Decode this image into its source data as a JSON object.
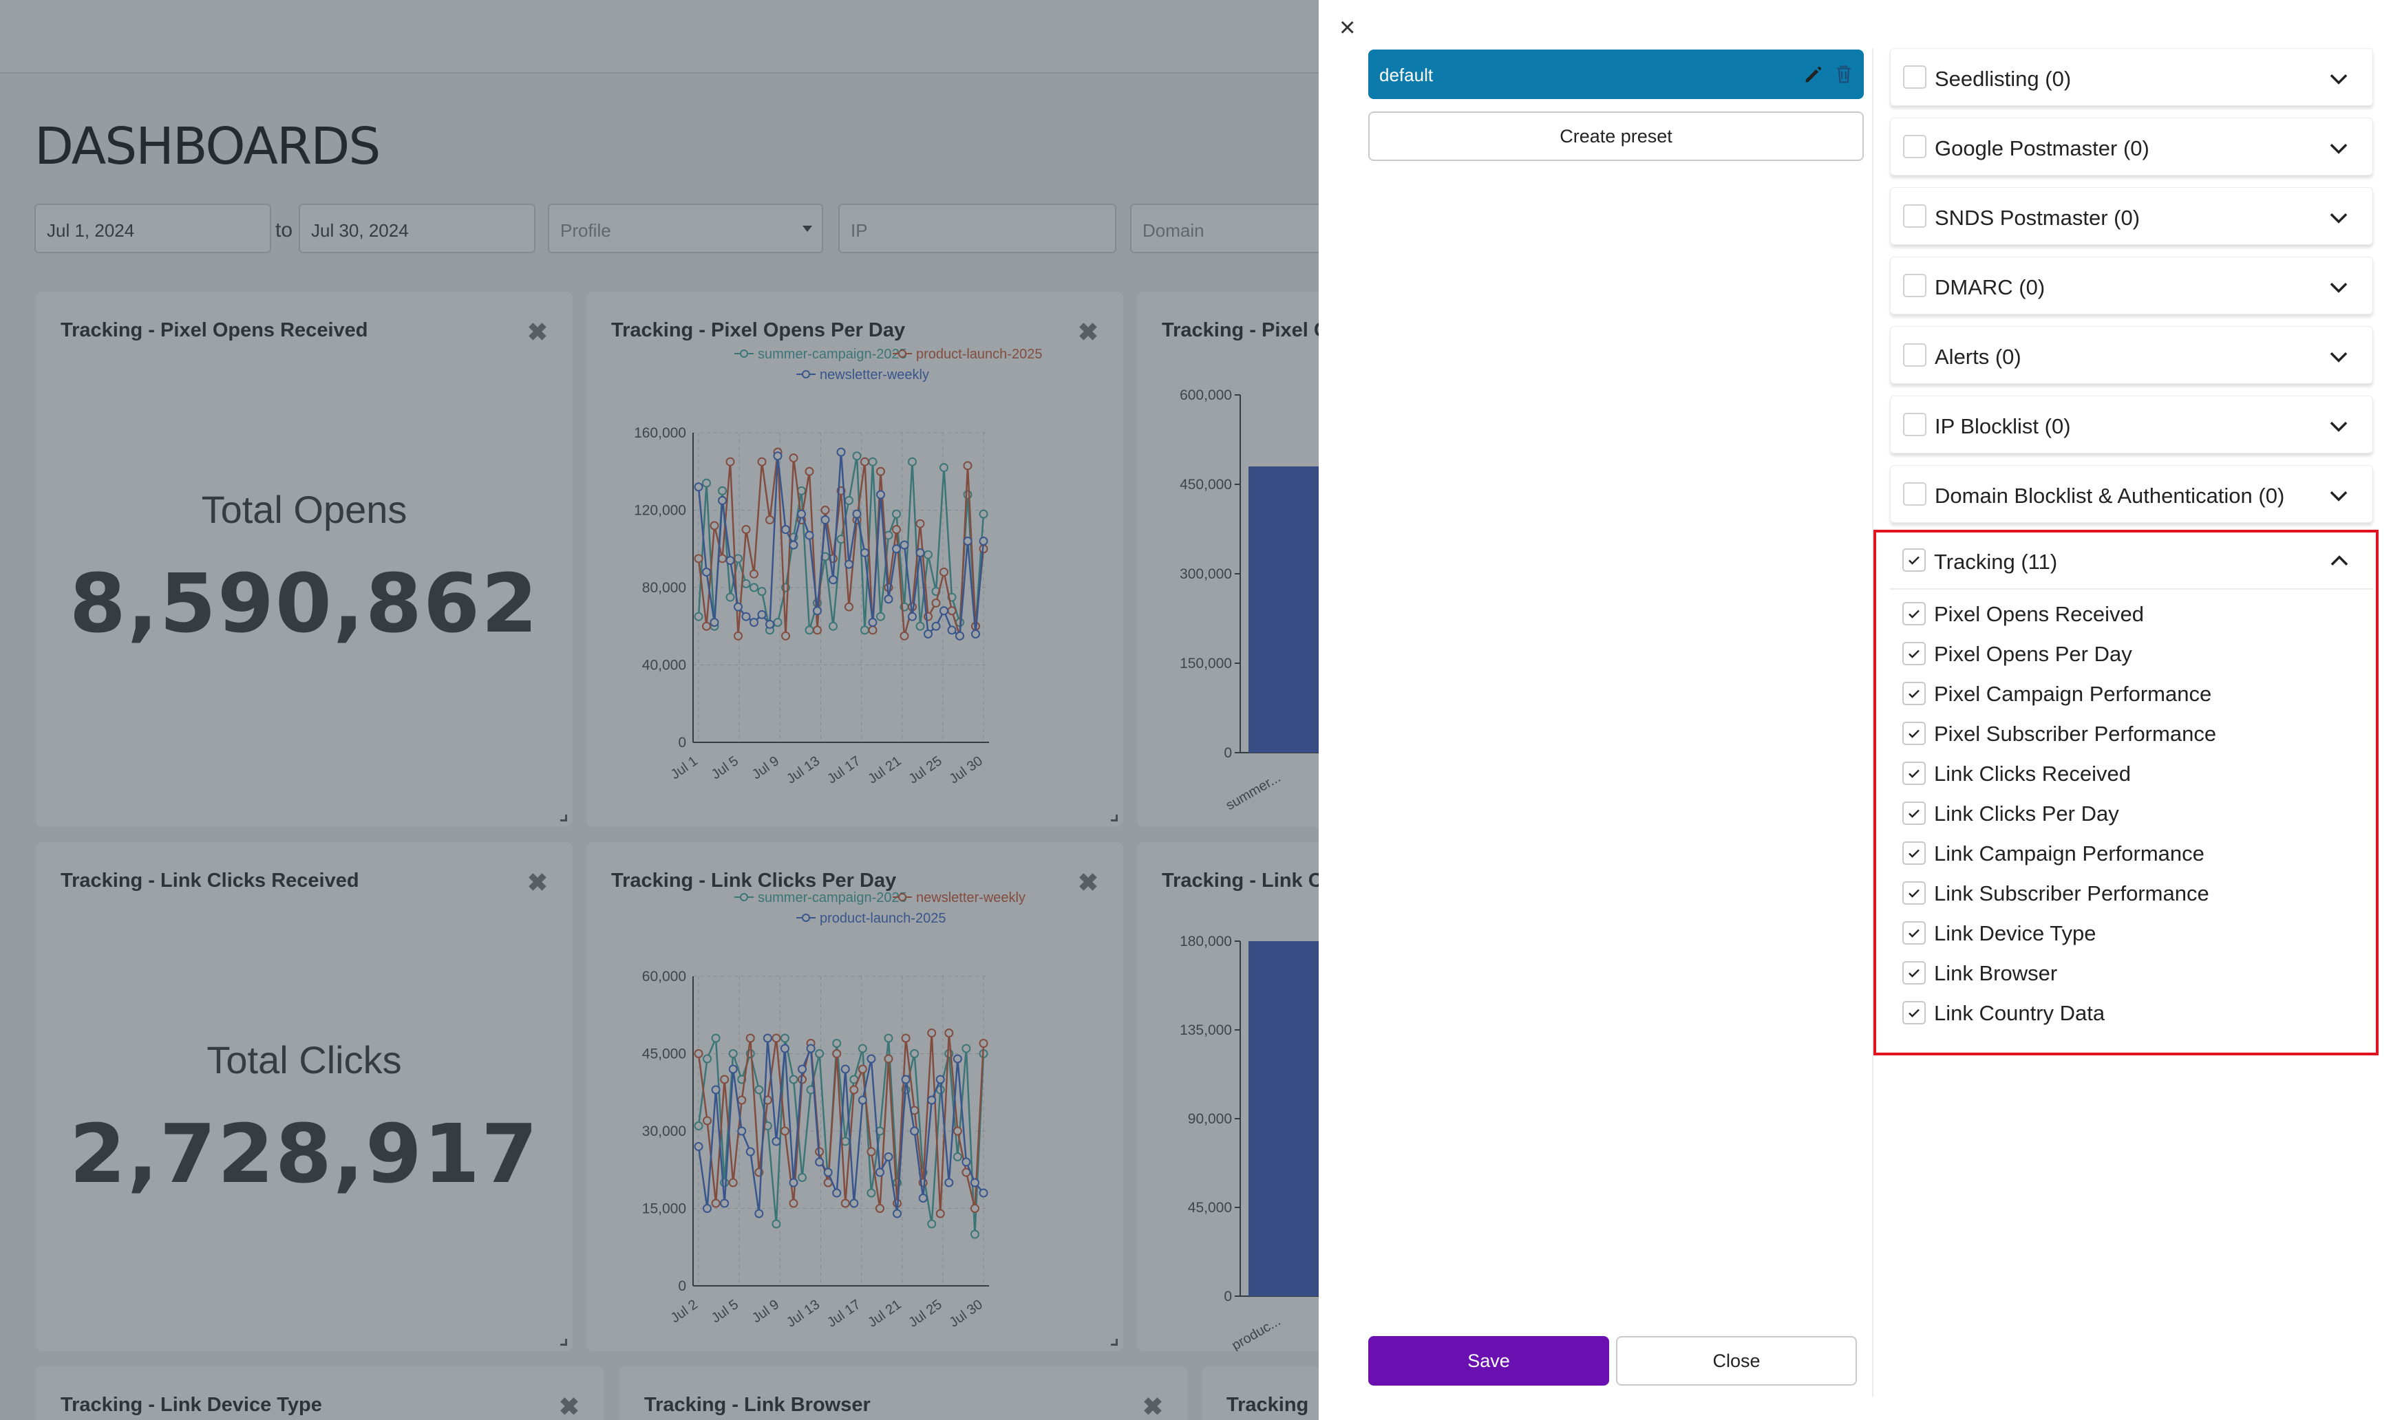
{
  "dashboard": {
    "title": "DASHBOARDS",
    "filters": {
      "date_from": "Jul 1, 2024",
      "to_label": "to",
      "date_to": "Jul 30, 2024",
      "profile_placeholder": "Profile",
      "ip_placeholder": "IP",
      "domain_placeholder": "Domain"
    },
    "cards": [
      {
        "title": "Tracking - Pixel Opens Received",
        "metric_label": "Total Opens",
        "metric_value": "8,590,862"
      },
      {
        "title": "Tracking - Pixel Opens Per Day"
      },
      {
        "title": "Tracking - Pixel C"
      },
      {
        "title": "Tracking - Link Clicks Received",
        "metric_label": "Total Clicks",
        "metric_value": "2,728,917"
      },
      {
        "title": "Tracking - Link Clicks Per Day"
      },
      {
        "title": "Tracking - Link C"
      },
      {
        "title": "Tracking - Link Device Type"
      },
      {
        "title": "Tracking - Link Browser"
      },
      {
        "title": "Tracking"
      }
    ],
    "close_symbol": "✖"
  },
  "chart_data": [
    {
      "type": "line",
      "title": "Tracking - Pixel Opens Per Day",
      "ylim": [
        0,
        160000
      ],
      "yticks": [
        "160,000",
        "120,000",
        "80,000",
        "40,000",
        "0"
      ],
      "xticks": [
        "Jul 1",
        "Jul 5",
        "Jul 9",
        "Jul 13",
        "Jul 17",
        "Jul 21",
        "Jul 25",
        "Jul 30"
      ],
      "series": [
        {
          "name": "summer-campaign-2025",
          "color": "#3aa59b",
          "values": [
            65000,
            134000,
            60000,
            130000,
            75000,
            95000,
            82000,
            80000,
            78000,
            58000,
            62000,
            80000,
            106000,
            130000,
            58000,
            72000,
            96000,
            60000,
            105000,
            125000,
            148000,
            58000,
            145000,
            65000,
            107000,
            118000,
            70000,
            145000,
            60000,
            97000,
            78000,
            142000,
            75000,
            62000,
            128000,
            60000,
            118000
          ]
        },
        {
          "name": "product-launch-2025",
          "color": "#c8532e",
          "values": [
            95000,
            60000,
            112000,
            95000,
            145000,
            55000,
            110000,
            87000,
            145000,
            115000,
            150000,
            55000,
            147000,
            115000,
            140000,
            58000,
            120000,
            95000,
            130000,
            70000,
            115000,
            145000,
            58000,
            140000,
            80000,
            110000,
            55000,
            70000,
            113000,
            65000,
            72000,
            88000,
            68000,
            55000,
            143000,
            60000,
            100000
          ]
        },
        {
          "name": "newsletter-weekly",
          "color": "#3565c8",
          "values": [
            132000,
            88000,
            62000,
            125000,
            94000,
            70000,
            65000,
            62000,
            66000,
            61000,
            148000,
            110000,
            102000,
            118000,
            107000,
            68000,
            115000,
            84000,
            150000,
            92000,
            118000,
            98000,
            62000,
            128000,
            74000,
            100000,
            102000,
            65000,
            98000,
            56000,
            60000,
            68000,
            58000,
            55000,
            104000,
            56000,
            104000
          ]
        }
      ]
    },
    {
      "type": "line",
      "title": "Tracking - Link Clicks Per Day",
      "ylim": [
        0,
        60000
      ],
      "yticks": [
        "60,000",
        "45,000",
        "30,000",
        "15,000",
        "0"
      ],
      "xticks": [
        "Jul 2",
        "Jul 5",
        "Jul 9",
        "Jul 13",
        "Jul 17",
        "Jul 21",
        "Jul 25",
        "Jul 30"
      ],
      "series": [
        {
          "name": "summer-campaign-2025",
          "color": "#3aa59b",
          "values": [
            31000,
            44000,
            48000,
            20000,
            45000,
            40000,
            45000,
            38000,
            31000,
            12000,
            48000,
            40000,
            21000,
            38000,
            45000,
            20000,
            47000,
            28000,
            40000,
            46000,
            18000,
            30000,
            48000,
            20000,
            38000,
            45000,
            22000,
            12000,
            38000,
            45000,
            25000,
            46000,
            10000,
            45000
          ]
        },
        {
          "name": "newsletter-weekly",
          "color": "#c8532e",
          "values": [
            45000,
            32000,
            16000,
            40000,
            20000,
            36000,
            48000,
            22000,
            36000,
            48000,
            30000,
            16000,
            40000,
            47000,
            26000,
            20000,
            45000,
            16000,
            38000,
            42000,
            26000,
            15000,
            44000,
            16000,
            48000,
            34000,
            20000,
            49000,
            14000,
            49000,
            30000,
            22000,
            15000,
            47000
          ]
        },
        {
          "name": "product-launch-2025",
          "color": "#3565c8",
          "values": [
            27000,
            15000,
            38000,
            16000,
            42000,
            30000,
            26000,
            14000,
            48000,
            28000,
            46000,
            20000,
            42000,
            46000,
            24000,
            22000,
            18000,
            42000,
            16000,
            36000,
            44000,
            22000,
            25000,
            14000,
            40000,
            30000,
            17000,
            36000,
            40000,
            20000,
            44000,
            24000,
            20000,
            18000
          ]
        }
      ]
    },
    {
      "type": "bar",
      "title": "Tracking - Pixel C",
      "ylim": [
        0,
        600000
      ],
      "yticks": [
        "600,000",
        "450,000",
        "300,000",
        "150,000",
        "0"
      ],
      "categories": [
        "summer..."
      ],
      "values": [
        480000
      ]
    },
    {
      "type": "bar",
      "title": "Tracking - Link C",
      "ylim": [
        0,
        180000
      ],
      "yticks": [
        "180,000",
        "135,000",
        "90,000",
        "45,000",
        "0"
      ],
      "categories": [
        "produc..."
      ],
      "values": [
        180000
      ]
    }
  ],
  "modal": {
    "close_icon": "×",
    "preset": {
      "name": "default"
    },
    "create_preset_label": "Create preset",
    "save_label": "Save",
    "close_label": "Close",
    "sections": [
      {
        "label": "Seedlisting (0)"
      },
      {
        "label": "Google Postmaster (0)"
      },
      {
        "label": "SNDS Postmaster (0)"
      },
      {
        "label": "DMARC (0)"
      },
      {
        "label": "Alerts (0)"
      },
      {
        "label": "IP Blocklist (0)"
      },
      {
        "label": "Domain Blocklist & Authentication (0)"
      }
    ],
    "tracking": {
      "label": "Tracking (11)",
      "items": [
        "Pixel Opens Received",
        "Pixel Opens Per Day",
        "Pixel Campaign Performance",
        "Pixel Subscriber Performance",
        "Link Clicks Received",
        "Link Clicks Per Day",
        "Link Campaign Performance",
        "Link Subscriber Performance",
        "Link Device Type",
        "Link Browser",
        "Link Country Data"
      ]
    },
    "accent_color": "#0d7aac",
    "save_color": "#6a0fb0",
    "highlight_color": "#e0141e"
  }
}
